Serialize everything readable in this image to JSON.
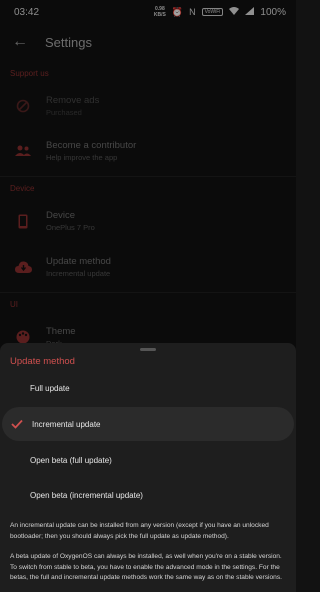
{
  "status_bar": {
    "time": "03:42",
    "net_speed_value": "0.98",
    "net_speed_unit": "KB/S",
    "vowifi": "VoWiFi",
    "battery": "100%"
  },
  "app_bar": {
    "title": "Settings"
  },
  "sections": {
    "support": {
      "header": "Support us",
      "items": [
        {
          "title": "Remove ads",
          "summary": "Purchased"
        },
        {
          "title": "Become a contributor",
          "summary": "Help improve the app"
        }
      ]
    },
    "device": {
      "header": "Device",
      "items": [
        {
          "title": "Device",
          "summary": "OnePlus 7 Pro"
        },
        {
          "title": "Update method",
          "summary": "Incremental update"
        }
      ]
    },
    "ui": {
      "header": "UI",
      "items": [
        {
          "title": "Theme",
          "summary": "Dark"
        }
      ]
    }
  },
  "sheet": {
    "title": "Update method",
    "options": [
      {
        "label": "Full update",
        "selected": false
      },
      {
        "label": "Incremental update",
        "selected": true
      },
      {
        "label": "Open beta (full update)",
        "selected": false
      },
      {
        "label": "Open beta (incremental update)",
        "selected": false
      }
    ],
    "info1": "An incremental update can be installed from any version (except if you have an unlocked bootloader; then you should always pick the full update as update method).",
    "info2": "A beta update of OxygenOS can always be installed, as well when you're on a stable version. To switch from stable to beta, you have to enable the advanced mode in the settings. For the betas, the full and incremental update methods work the same way as on the stable versions."
  },
  "colors": {
    "accent": "#d0504f",
    "background": "#121212",
    "sheet": "#1e1e1e"
  },
  "icons": {
    "back": "arrow-left-icon",
    "remove_ads": "block-icon",
    "contributor": "people-icon",
    "device": "phone-icon",
    "update_method": "cloud-download-icon",
    "theme": "palette-icon",
    "check": "check-icon"
  }
}
